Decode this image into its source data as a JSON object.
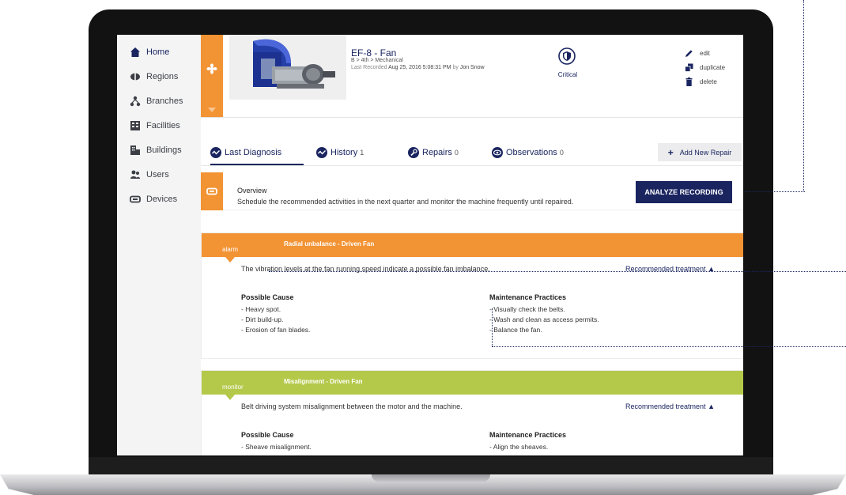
{
  "sidebar": {
    "items": [
      {
        "label": "Home",
        "icon": "home-icon"
      },
      {
        "label": "Regions",
        "icon": "regions-icon"
      },
      {
        "label": "Branches",
        "icon": "branches-icon"
      },
      {
        "label": "Facilities",
        "icon": "facilities-icon"
      },
      {
        "label": "Buildings",
        "icon": "buildings-icon"
      },
      {
        "label": "Users",
        "icon": "users-icon"
      },
      {
        "label": "Devices",
        "icon": "devices-icon"
      }
    ]
  },
  "asset": {
    "title": "EF-8 - Fan",
    "path": "B > 4th > Mechanical",
    "recorded_prefix": "Last Recorded",
    "recorded_date": "Aug 25, 2016 5:08:31 PM",
    "recorded_by_prefix": "by",
    "recorded_by": "Jon Snow",
    "status": "Critical"
  },
  "actions": {
    "edit": "edit",
    "duplicate": "duplicate",
    "delete": "delete"
  },
  "tabs": [
    {
      "label": "Last Diagnosis",
      "count": ""
    },
    {
      "label": "History",
      "count": "1"
    },
    {
      "label": "Repairs",
      "count": "0"
    },
    {
      "label": "Observations",
      "count": "0"
    }
  ],
  "add_repair_label": "Add New Repair",
  "overview": {
    "title": "Overview",
    "text": "Schedule the recommended activities in the next quarter and monitor the machine frequently until repaired.",
    "button": "ANALYZE RECORDING"
  },
  "alerts": [
    {
      "level": "alarm",
      "name": "Radial unbalance - Driven Fan",
      "description": "The vibration levels at the fan running speed indicate a possible fan imbalance.",
      "treatment_link": "Recommended treatment",
      "cause_heading": "Possible Cause",
      "causes": [
        "- Heavy spot.",
        "- Dirt build-up.",
        "- Erosion of fan blades."
      ],
      "practice_heading": "Maintenance Practices",
      "practices": [
        "- Visually check the belts.",
        "- Wash and clean as access permits.",
        "- Balance the fan."
      ]
    },
    {
      "level": "monitor",
      "name": "Misalignment - Driven Fan",
      "description": "Belt driving system misalignment between the motor and the machine.",
      "treatment_link": "Recommended treatment",
      "cause_heading": "Possible Cause",
      "causes": [
        "- Sheave misalignment."
      ],
      "practice_heading": "Maintenance Practices",
      "practices": [
        "- Align the sheaves."
      ]
    }
  ],
  "colors": {
    "navy": "#1a2560",
    "alarm": "#f29334",
    "monitor": "#b4c94a",
    "sidebar_bg": "#f4f4f5"
  }
}
